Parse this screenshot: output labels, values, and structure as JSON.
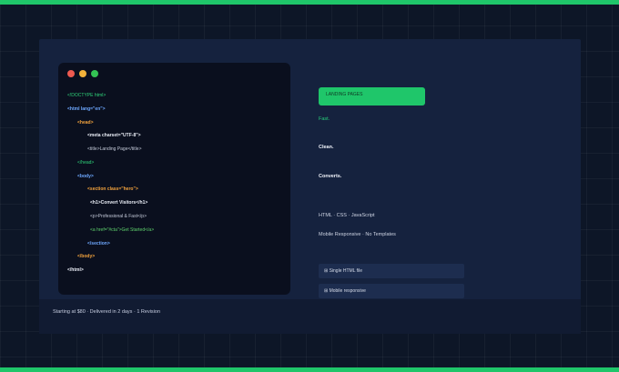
{
  "code": {
    "lines": [
      "<!DOCTYPE html>",
      "<html lang=\"en\">",
      "<head>",
      "<meta charset=\"UTF-8\">",
      "<title>Landing Page</title>",
      "</head>",
      "<body>",
      "<section class=\"hero\">",
      "<h1>Convert Visitors</h1>",
      "<p>Professional & Fast</p>",
      "<a href=\"#cta\">Get Started</a>",
      "</section>",
      "</body>",
      "</html>"
    ]
  },
  "hero": {
    "badge": "LANDING PAGES",
    "word_fast": "Fast.",
    "word_clean": "Clean.",
    "word_converts": "Converts.",
    "tech": "HTML · CSS · JavaScript",
    "notes": "Mobile Responsive · No Templates"
  },
  "features": [
    "⊞ Single HTML file",
    "⊞ Mobile responsive"
  ],
  "footer": {
    "text": "Starting at $80  ·  Delivered in 2 days  ·  1 Revision"
  },
  "colors": {
    "accent": "#1fc66a",
    "background": "#0d1627",
    "card": "#15223e"
  }
}
